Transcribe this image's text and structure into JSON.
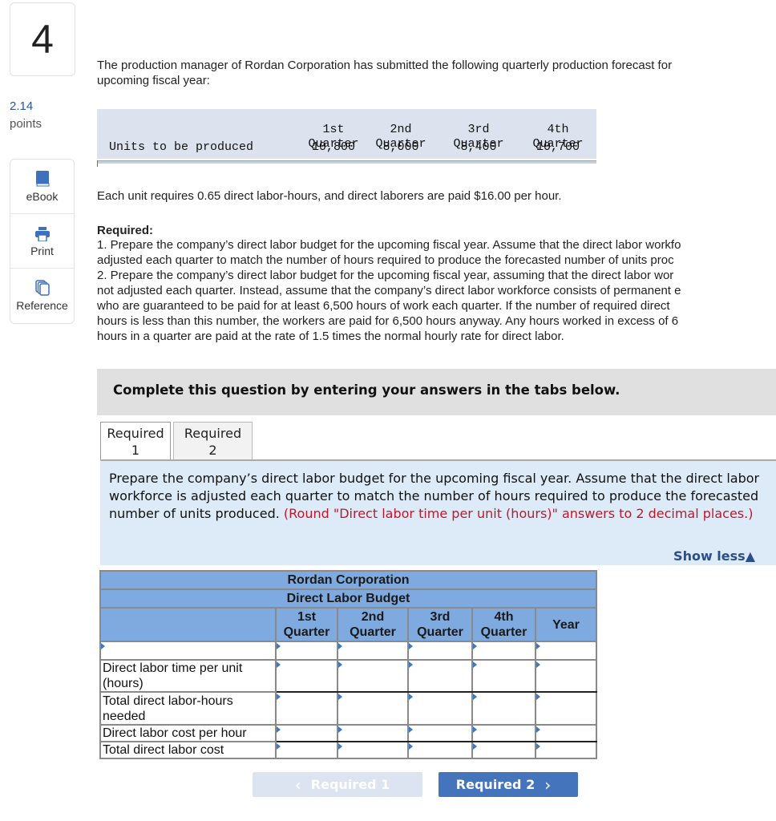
{
  "question": {
    "number": "4",
    "points_value": "2.14",
    "points_label": "points"
  },
  "tools": [
    {
      "label": "eBook",
      "icon": "book-icon"
    },
    {
      "label": "Print",
      "icon": "printer-icon"
    },
    {
      "label": "Reference",
      "icon": "copy-icon"
    }
  ],
  "intro": {
    "line1": "The production manager of Rordan Corporation has submitted the following quarterly production forecast for",
    "line2": "upcoming fiscal year:"
  },
  "forecast_table": {
    "header_line1": [
      "1st",
      "2nd",
      "3rd",
      "4th"
    ],
    "header_line2": [
      "Quarter",
      "Quarter",
      "Quarter",
      "Quarter"
    ],
    "row_label": "Units to be produced",
    "values": [
      "10,800",
      "8,000",
      "8,400",
      "10,700"
    ]
  },
  "unit_info": "Each unit requires 0.65 direct labor-hours, and direct laborers are paid $16.00 per hour.",
  "required": {
    "heading": "Required:",
    "lines": [
      "1. Prepare the company’s direct labor budget for the upcoming fiscal year. Assume that the direct labor workfo",
      "adjusted each quarter to match the number of hours required to produce the forecasted number of units proc",
      "2. Prepare the company’s direct labor budget for the upcoming fiscal year, assuming that the direct labor wor",
      "not adjusted each quarter. Instead, assume that the company’s direct labor workforce consists of permanent e",
      "who are guaranteed to be paid for at least 6,500 hours of work each quarter. If the number of required direct",
      "hours is less than this number, the workers are paid for 6,500 hours anyway. Any hours worked in excess of 6",
      "hours in a quarter are paid at the rate of 1.5 times the normal hourly rate for direct labor."
    ]
  },
  "instruction_banner": "Complete this question by entering your answers in the tabs below.",
  "tabs": [
    {
      "line1": "Required",
      "line2": "1",
      "active": true
    },
    {
      "line1": "Required",
      "line2": "2",
      "active": false
    }
  ],
  "panel": {
    "text": "Prepare the company’s direct labor budget for the upcoming fiscal year. Assume that the direct labor workforce is adjusted each quarter to match the number of hours required to produce the forecasted number of units produced. ",
    "note": "(Round \"Direct labor time per unit (hours)\" answers to 2 decimal places.)",
    "show_less": "Show less▲"
  },
  "budget": {
    "company": "Rordan Corporation",
    "title": "Direct Labor Budget",
    "columns": [
      {
        "line1": "1st",
        "line2": "Quarter"
      },
      {
        "line1": "2nd",
        "line2": "Quarter"
      },
      {
        "line1": "3rd",
        "line2": "Quarter"
      },
      {
        "line1": "4th",
        "line2": "Quarter"
      },
      {
        "line1": "Year",
        "line2": ""
      }
    ],
    "rows": [
      {
        "label": "",
        "values": [
          "",
          "",
          "",
          "",
          ""
        ]
      },
      {
        "label": "Direct labor time per unit (hours)",
        "values": [
          "",
          "",
          "",
          "",
          ""
        ]
      },
      {
        "label": "Total direct labor-hours needed",
        "values": [
          "",
          "",
          "",
          "",
          ""
        ]
      },
      {
        "label": "Direct labor cost per hour",
        "values": [
          "",
          "",
          "",
          "",
          ""
        ]
      },
      {
        "label": "Total direct labor cost",
        "values": [
          "",
          "",
          "",
          "",
          ""
        ]
      }
    ]
  },
  "nav": {
    "prev_label": "Required 1",
    "next_label": "Required 2",
    "prev_disabled": true
  },
  "colors": {
    "accent_blue": "#4474bb",
    "table_header": "#7eaadf",
    "panel_bg": "#ddeaf7",
    "note_red": "#c0182a"
  }
}
